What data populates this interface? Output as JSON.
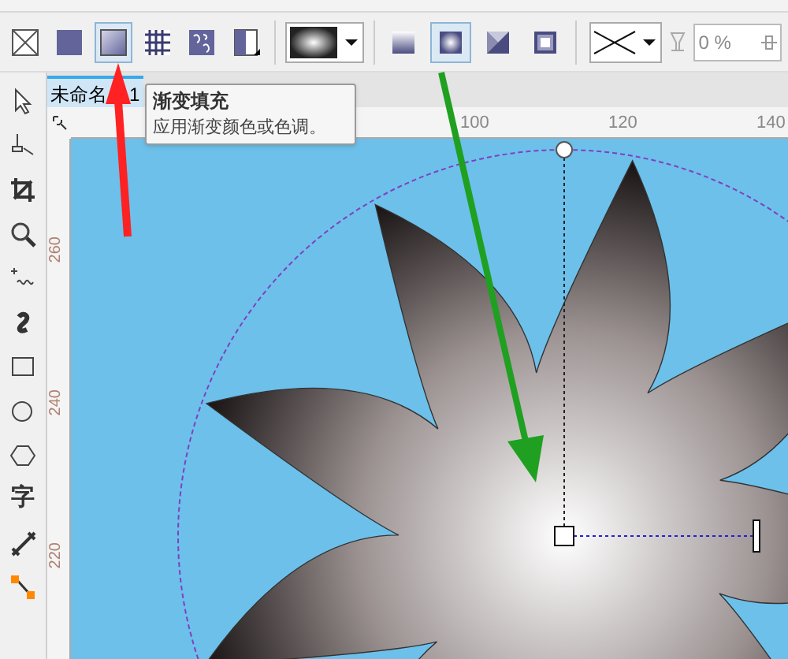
{
  "fill_types": [
    {
      "kind": "none",
      "selected": false
    },
    {
      "kind": "uniform",
      "selected": false
    },
    {
      "kind": "fountain",
      "selected": true
    },
    {
      "kind": "pattern",
      "selected": false
    },
    {
      "kind": "texture",
      "selected": false
    },
    {
      "kind": "postscript",
      "selected": false
    }
  ],
  "fountain_types": [
    {
      "kind": "linear",
      "selected": false
    },
    {
      "kind": "elliptical",
      "selected": true
    },
    {
      "kind": "conical",
      "selected": false
    },
    {
      "kind": "rectangular",
      "selected": false
    }
  ],
  "transparency": {
    "value": "0 %"
  },
  "document_tab": {
    "label_parts": [
      "未命名",
      "1"
    ]
  },
  "tooltip": {
    "title": "渐变填充",
    "description": "应用渐变颜色或色调。"
  },
  "tools": [
    {
      "kind": "pick"
    },
    {
      "kind": "shape"
    },
    {
      "kind": "crop"
    },
    {
      "kind": "zoom"
    },
    {
      "kind": "freehand"
    },
    {
      "kind": "artistic"
    },
    {
      "kind": "rectangle"
    },
    {
      "kind": "ellipse"
    },
    {
      "kind": "polygon"
    },
    {
      "kind": "text",
      "label": "字"
    },
    {
      "kind": "dimension"
    },
    {
      "kind": "connector"
    }
  ],
  "horizontal_ruler": [
    "100",
    "120",
    "140"
  ],
  "vertical_ruler": [
    "260",
    "240",
    "220"
  ]
}
